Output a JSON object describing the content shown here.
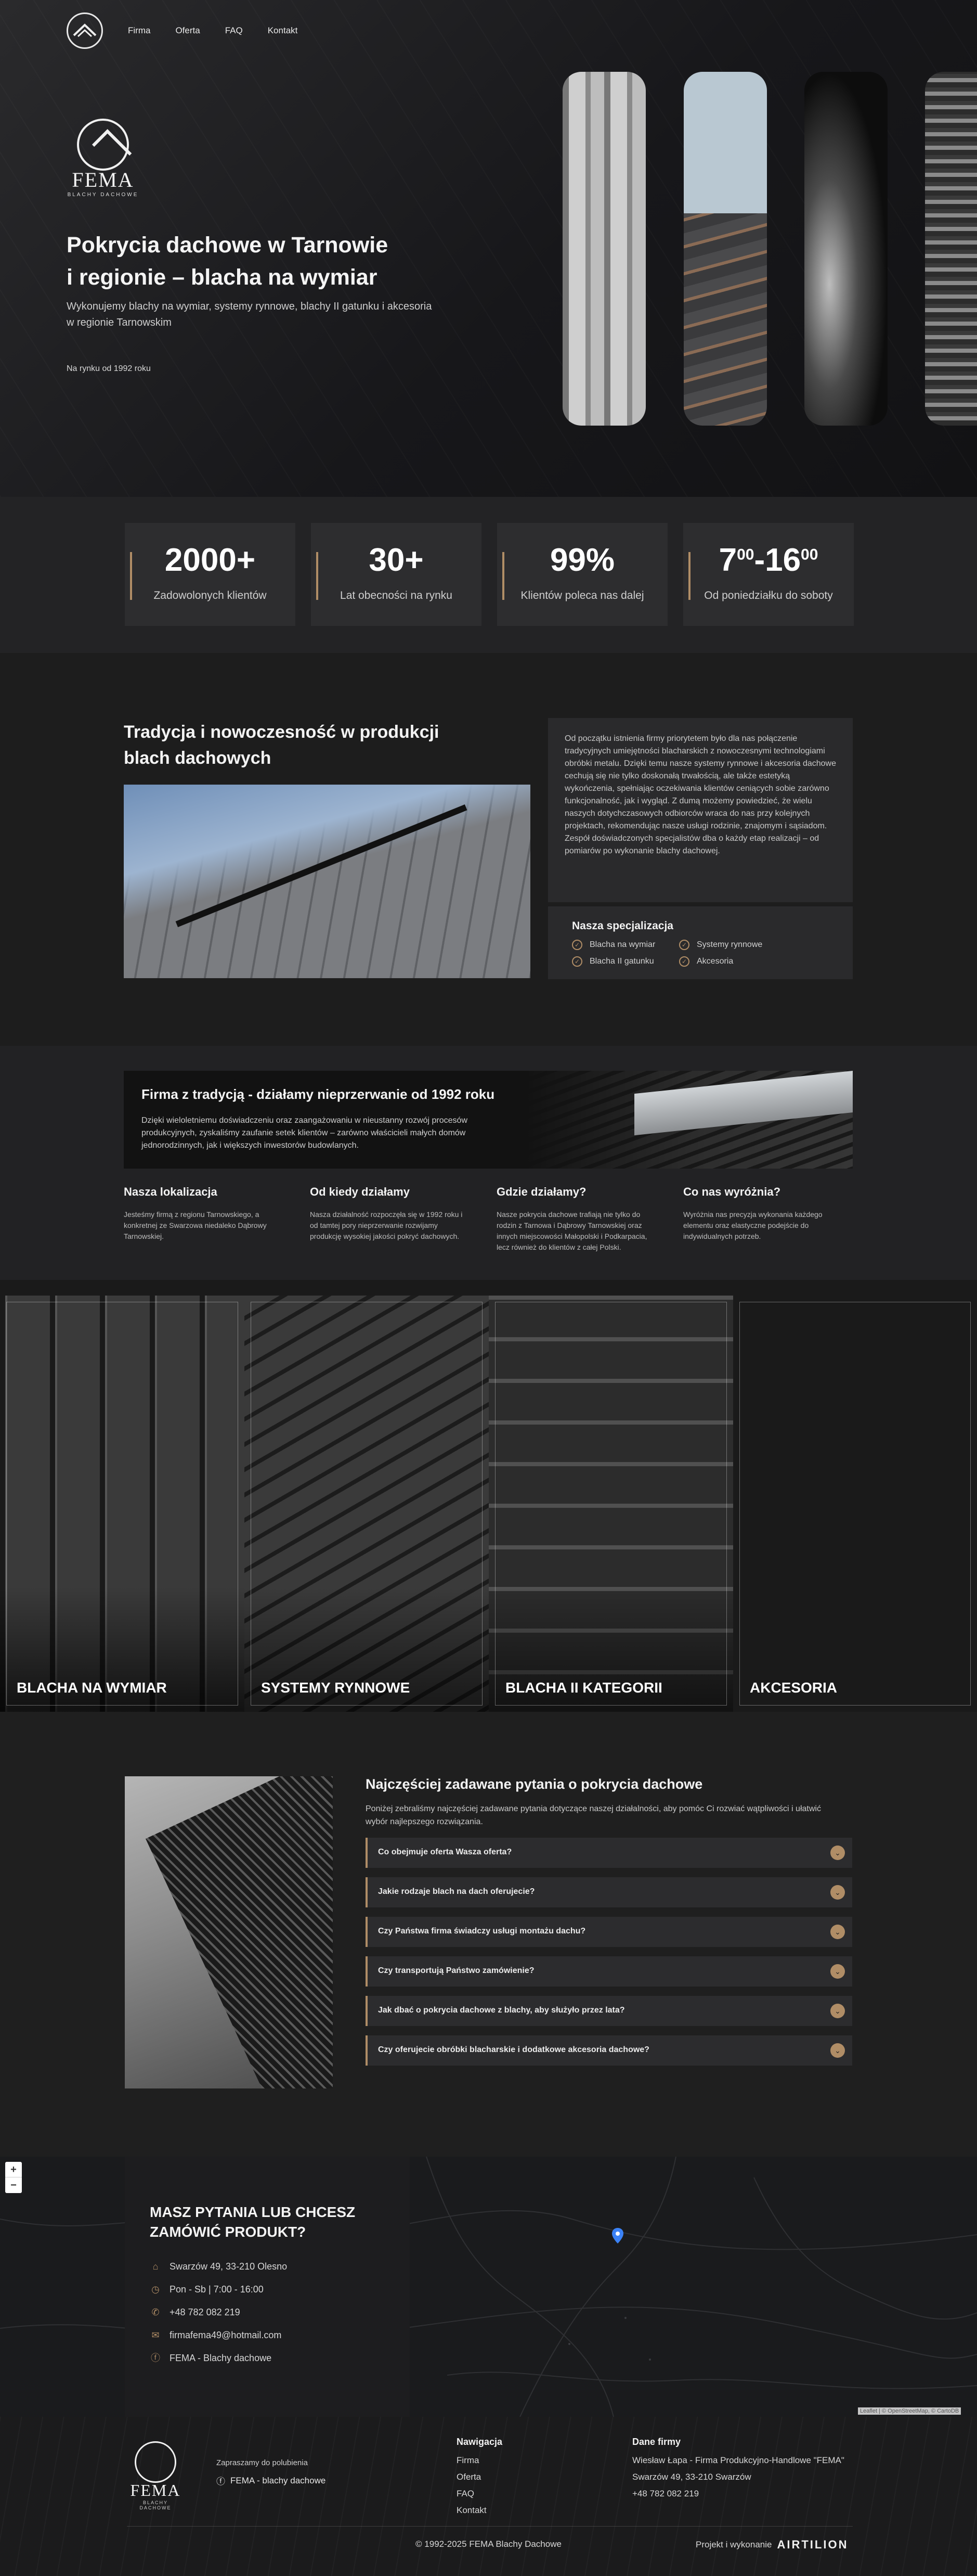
{
  "nav": {
    "items": [
      "Firma",
      "Oferta",
      "FAQ",
      "Kontakt"
    ]
  },
  "brand": {
    "name": "FEMA",
    "sub": "BLACHY DACHOWE"
  },
  "hero": {
    "title_line1": "Pokrycia dachowe w Tarnowie",
    "title_line2": "i regionie – blacha na wymiar",
    "desc": "Wykonujemy blachy na wymiar, systemy rynnowe, blachy II gatunku i akcesoria w regionie Tarnowskim",
    "since": "Na rynku od 1992 roku"
  },
  "stats": [
    {
      "num": "2000+",
      "label": "Zadowolonych klientów"
    },
    {
      "num": "30+",
      "label": "Lat obecności na rynku"
    },
    {
      "num": "99%",
      "label": "Klientów poleca nas dalej"
    },
    {
      "num_a": "7",
      "sup_a": "00",
      "num_b": "-16",
      "sup_b": "00",
      "label": "Od poniedziałku do soboty"
    }
  ],
  "tradition": {
    "title": "Tradycja i nowoczesność w produkcji blach dachowych",
    "text": "Od początku istnienia firmy priorytetem było dla nas połączenie tradycyjnych umiejętności blacharskich z nowoczesnymi technologiami obróbki metalu. Dzięki temu nasze systemy rynnowe i akcesoria dachowe cechują się nie tylko doskonałą trwałością, ale także estetyką wykończenia, spełniając oczekiwania klientów ceniących sobie zarówno funkcjonalność, jak i wygląd. Z dumą możemy powiedzieć, że wielu naszych dotychczasowych odbiorców wraca do nas przy kolejnych projektach, rekomendując nasze usługi rodzinie, znajomym i sąsiadom. Zespół doświadczonych specjalistów dba o każdy etap realizacji – od pomiarów po wykonanie blachy dachowej.",
    "spec_title": "Nasza specjalizacja",
    "spec": [
      "Blacha na wymiar",
      "Systemy rynnowe",
      "Blacha II gatunku",
      "Akcesoria"
    ]
  },
  "history": {
    "title": "Firma z tradycją - działamy nieprzerwanie od 1992 roku",
    "text": "Dzięki wieloletniemu doświadczeniu oraz zaangażowaniu w nieustanny rozwój procesów produkcyjnych, zyskaliśmy zaufanie setek klientów – zarówno właścicieli małych domów jednorodzinnych, jak i większych inwestorów budowlanych.",
    "cols": [
      {
        "title": "Nasza lokalizacja",
        "text": "Jesteśmy firmą z regionu Tarnowskiego, a konkretnej ze Swarzowa niedaleko Dąbrowy Tarnowskiej."
      },
      {
        "title": "Od kiedy działamy",
        "text": "Nasza działalność rozpoczęła się w 1992 roku i od tamtej pory nieprzerwanie rozwijamy produkcję wysokiej jakości pokryć dachowych."
      },
      {
        "title": "Gdzie działamy?",
        "text": "Nasze pokrycia dachowe trafiają nie tylko do rodzin z Tarnowa i Dąbrowy Tarnowskiej oraz innych miejscowości Małopolski i Podkarpacia, lecz również do klientów z całej Polski."
      },
      {
        "title": "Co nas wyróżnia?",
        "text": "Wyróżnia nas precyzja wykonania każdego elementu oraz elastyczne podejście do indywidualnych potrzeb."
      }
    ]
  },
  "products": [
    "BLACHA NA WYMIAR",
    "SYSTEMY RYNNOWE",
    "BLACHA II KATEGORII",
    "AKCESORIA"
  ],
  "faq": {
    "title": "Najczęściej zadawane pytania o pokrycia dachowe",
    "desc": "Poniżej zebraliśmy najczęściej zadawane pytania dotyczące naszej działalności, aby pomóc Ci rozwiać wątpliwości i ułatwić wybór najlepszego rozwiązania.",
    "items": [
      "Co obejmuje oferta Wasza oferta?",
      "Jakie rodzaje blach na dach oferujecie?",
      "Czy Państwa firma świadczy usługi montażu dachu?",
      "Czy transportują Państwo zamówienie?",
      "Jak dbać o pokrycia dachowe z blachy, aby służyło przez lata?",
      "Czy oferujecie obróbki blacharskie i dodatkowe akcesoria dachowe?"
    ]
  },
  "contact": {
    "title": "MASZ PYTANIA LUB CHCESZ ZAMÓWIĆ PRODUKT?",
    "address": "Swarzów 49, 33-210 Olesno",
    "hours": "Pon - Sb | 7:00 - 16:00",
    "phone": "+48 782 082 219",
    "email": "firmafema49@hotmail.com",
    "facebook": "FEMA - Blachy dachowe"
  },
  "map": {
    "zoom_in": "+",
    "zoom_out": "−",
    "attribution": "Leaflet | © OpenStreetMap, © CartoDB"
  },
  "footer": {
    "invite": "Zapraszamy do polubienia",
    "fb": "FEMA - blachy dachowe",
    "nav_title": "Nawigacja",
    "nav": [
      "Firma",
      "Oferta",
      "FAQ",
      "Kontakt"
    ],
    "data_title": "Dane firmy",
    "data": [
      "Wiesław Łapa - Firma Produkcyjno-Handlowe \"FEMA\"",
      "Swarzów 49, 33-210 Swarzów",
      "+48 782 082 219"
    ],
    "copyright": "© 1992-2025 FEMA Blachy Dachowe",
    "project": "Projekt i wykonanie",
    "project_logo": "AIRTILION"
  },
  "colors": {
    "accent": "#b08d66",
    "bg": "#1c1c1c",
    "card": "#2d2d2f"
  }
}
